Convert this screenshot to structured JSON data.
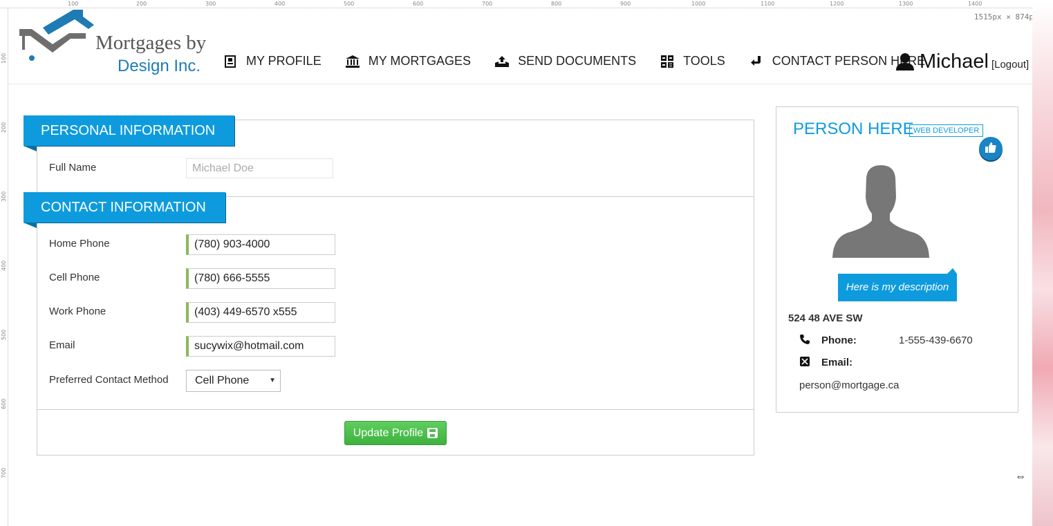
{
  "ruler": {
    "top_ticks": [
      "100",
      "200",
      "300",
      "400",
      "500",
      "600",
      "700",
      "800",
      "900",
      "1000",
      "1100",
      "1200",
      "1300",
      "1400"
    ],
    "left_ticks": [
      "100",
      "200",
      "300",
      "400",
      "500",
      "600",
      "700"
    ],
    "dimensions": "1515px × 874p"
  },
  "brand": {
    "line1": "Mortgages by",
    "line2": "Design Inc.",
    "logo_icon": "house-roof-logo-icon"
  },
  "nav": {
    "items": [
      {
        "label": "MY PROFILE",
        "icon": "profile-card-icon"
      },
      {
        "label": "MY MORTGAGES",
        "icon": "bank-icon"
      },
      {
        "label": "SEND DOCUMENTS",
        "icon": "upload-tray-icon"
      },
      {
        "label": "TOOLS",
        "icon": "calculator-icon"
      },
      {
        "label": "CONTACT PERSON HERE",
        "icon": "reply-arrow-icon"
      }
    ],
    "user": {
      "name": "Michael",
      "logout": "[Logout]",
      "icon": "user-silhouette-icon"
    }
  },
  "personal": {
    "heading": "PERSONAL INFORMATION",
    "full_name_label": "Full Name",
    "full_name_value": "Michael Doe"
  },
  "contact": {
    "heading": "CONTACT INFORMATION",
    "fields": [
      {
        "label": "Home Phone",
        "value": "(780) 903-4000"
      },
      {
        "label": "Cell Phone",
        "value": "(780) 666-5555"
      },
      {
        "label": "Work Phone",
        "value": "(403) 449-6570 x555"
      },
      {
        "label": "Email",
        "value": "sucywix@hotmail.com"
      }
    ],
    "preferred_label": "Preferred Contact Method",
    "preferred_value": "Cell Phone"
  },
  "actions": {
    "update_label": "Update Profile",
    "update_icon": "floppy-disk-icon"
  },
  "agent": {
    "name": "PERSON HERE",
    "role": "WEB DEVELOPER",
    "description": "Here is my description",
    "address": "524 48 AVE SW",
    "phone_label": "Phone:",
    "phone_value": "1-555-439-6670",
    "email_label": "Email:",
    "email_value": "person@mortgage.ca",
    "like_icon": "thumbs-up-icon"
  },
  "colors": {
    "accent": "#0e9bde",
    "brand_blue": "#1e7bb3",
    "success": "#4cbf4c",
    "field_marker": "#8cb85b"
  }
}
